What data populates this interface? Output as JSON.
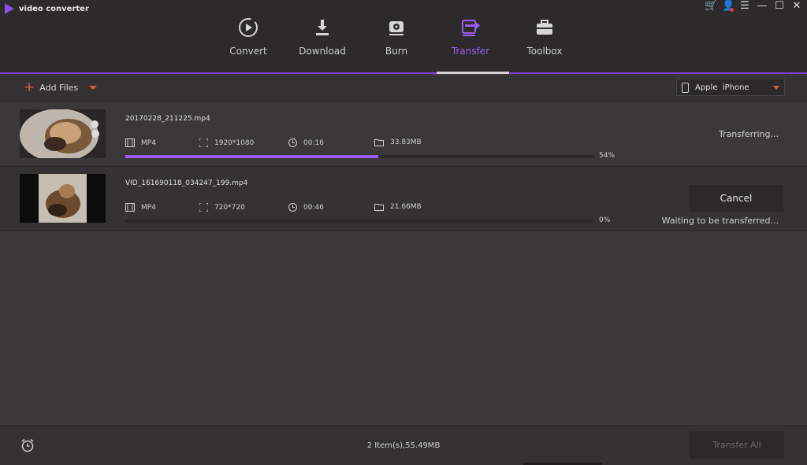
{
  "app": {
    "title": "video converter"
  },
  "window_controls": [
    "cart-icon",
    "user-icon",
    "menu-icon",
    "minimize-icon",
    "maximize-icon",
    "close-icon"
  ],
  "tabs": [
    {
      "label": "Convert",
      "icon": "convert-icon",
      "active": false
    },
    {
      "label": "Download",
      "icon": "download-icon",
      "active": false
    },
    {
      "label": "Burn",
      "icon": "burn-icon",
      "active": false
    },
    {
      "label": "Transfer",
      "icon": "transfer-icon",
      "active": true
    },
    {
      "label": "Toolbox",
      "icon": "toolbox-icon",
      "active": false
    }
  ],
  "toolbar": {
    "add_files_label": "Add Files",
    "device": "Apple  iPhone"
  },
  "files": [
    {
      "name": "20170228_211225.mp4",
      "format": "MP4",
      "resolution": "1920*1080",
      "duration": "00:16",
      "size": "33.83MB",
      "progress": 54,
      "progress_label": "54%",
      "status": "Transferring..."
    },
    {
      "name": "VID_161690118_034247_199.mp4",
      "format": "MP4",
      "resolution": "720*720",
      "duration": "00:46",
      "size": "21.66MB",
      "progress": 0,
      "progress_label": "0%",
      "status": "Waiting to be transferred...",
      "action_label": "Cancel"
    }
  ],
  "footer": {
    "summary": "2 Item(s),55.49MB",
    "transfer_all_label": "Transfer All"
  },
  "colors": {
    "accent": "#9b5cf0",
    "background": "#3a3839",
    "header": "#2c2a2b"
  }
}
